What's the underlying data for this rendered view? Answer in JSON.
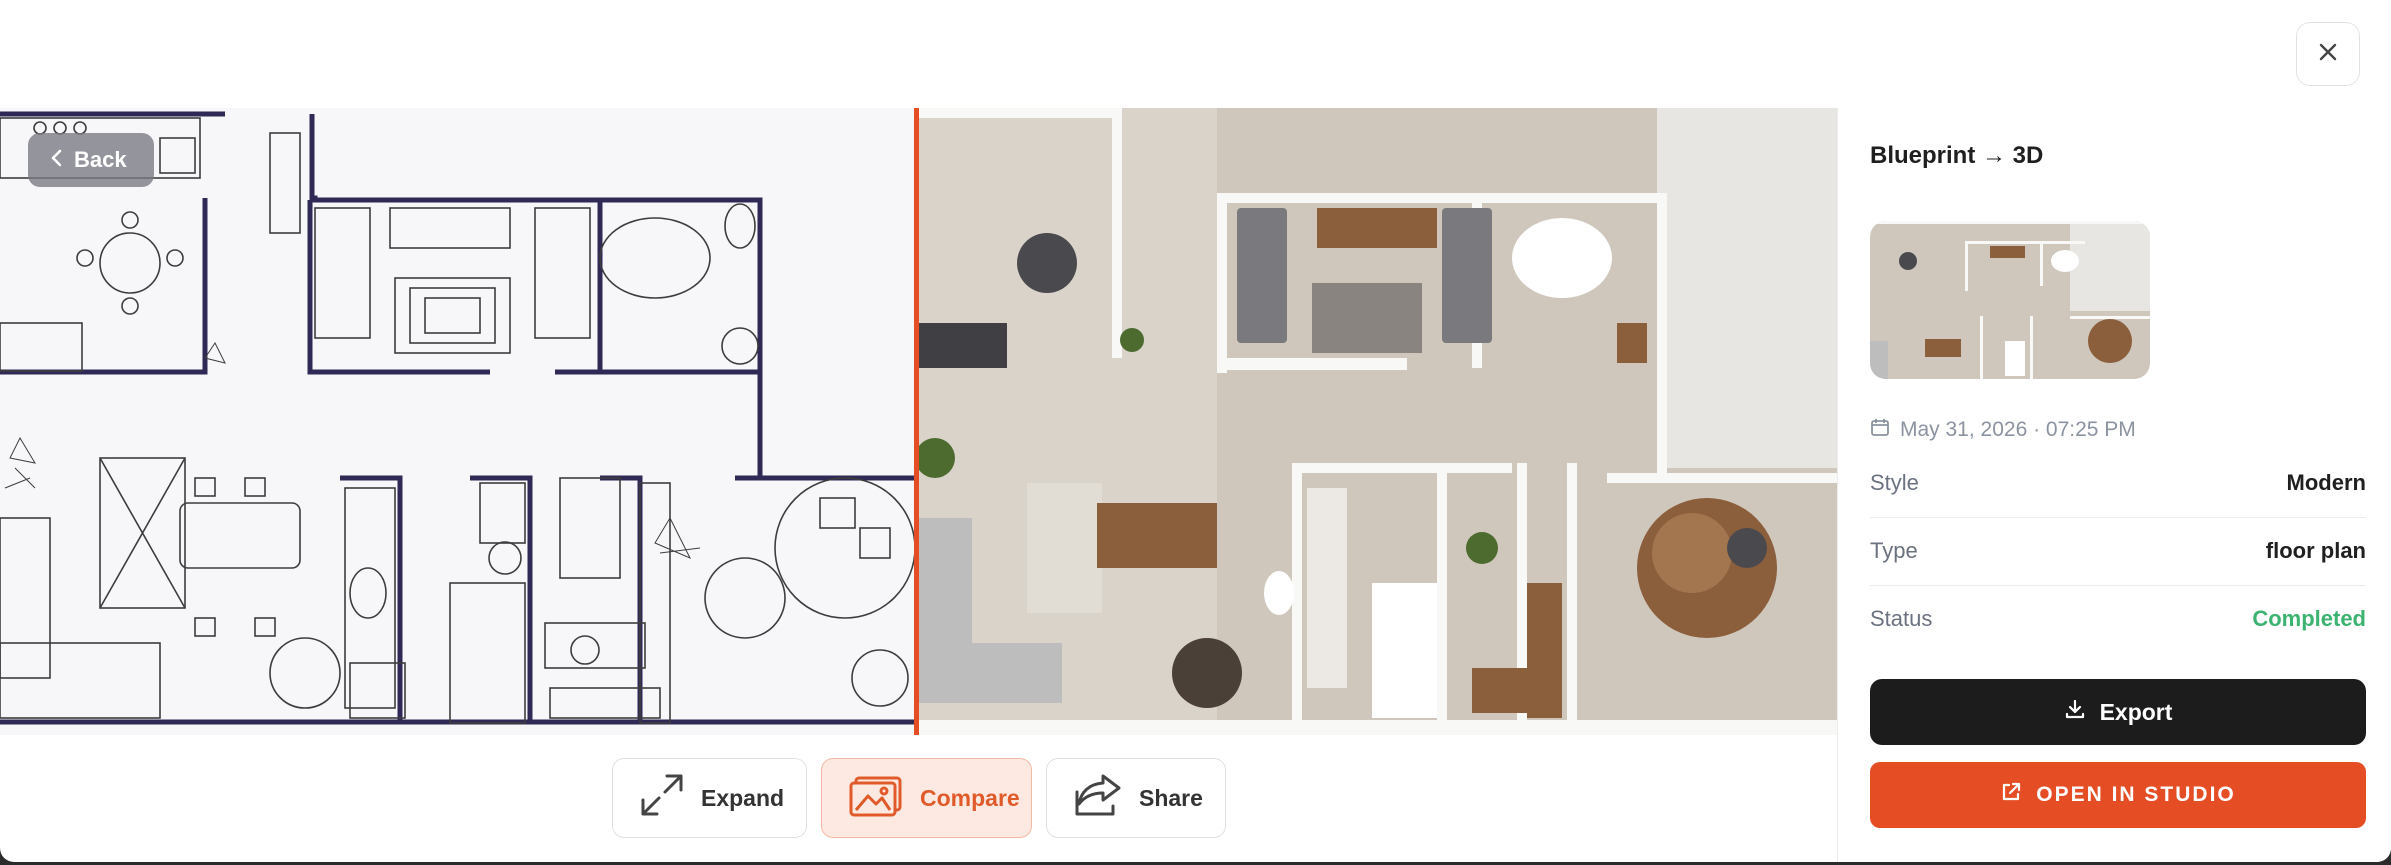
{
  "viewer": {
    "back_label": "Back"
  },
  "toolbar": {
    "expand_label": "Expand",
    "compare_label": "Compare",
    "share_label": "Share"
  },
  "panel": {
    "title": "Blueprint → 3D",
    "date": "May 31, 2026 · 07:25 PM",
    "rows": [
      {
        "label": "Style",
        "value": "Modern"
      },
      {
        "label": "Type",
        "value": "floor plan"
      },
      {
        "label": "Status",
        "value": "Completed"
      }
    ],
    "export_label": "Export",
    "studio_label": "OPEN IN STUDIO"
  },
  "colors": {
    "accent": "#e54e25",
    "status_ok": "#3cb371",
    "dark_button": "#1c1c1c",
    "compare_active_bg": "#fde9e1"
  },
  "icons": [
    "close-icon",
    "chevron-left-icon",
    "expand-icon",
    "compare-icon",
    "share-icon",
    "calendar-icon",
    "download-icon",
    "external-link-icon"
  ]
}
